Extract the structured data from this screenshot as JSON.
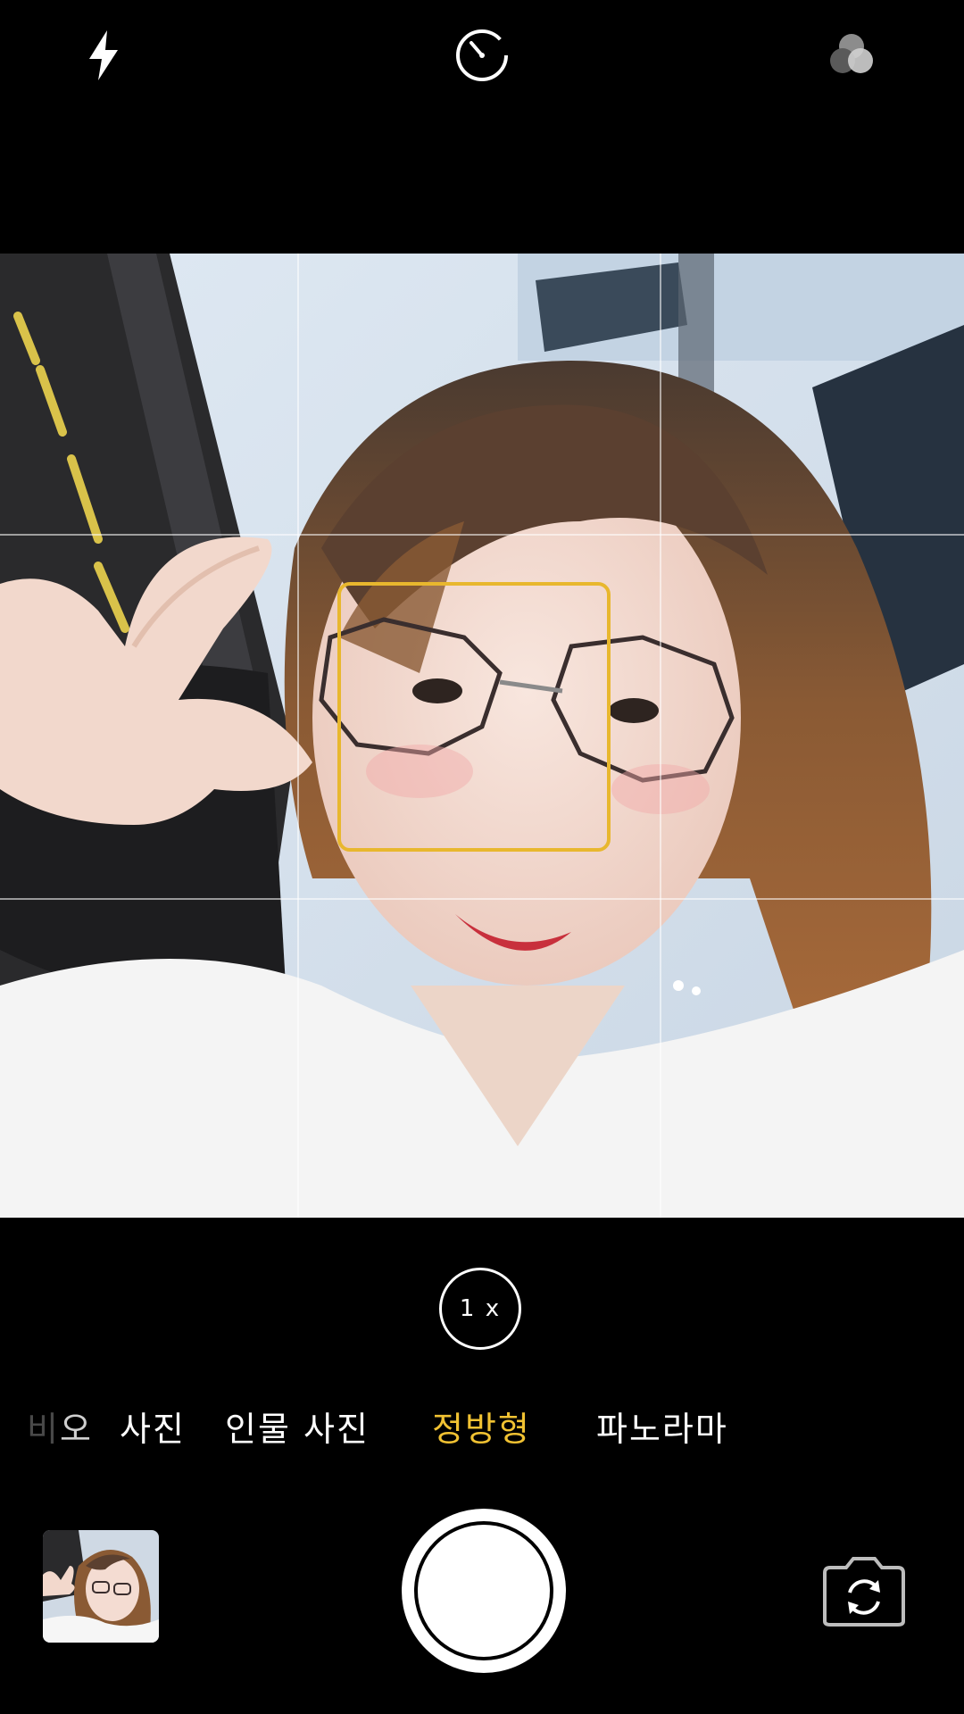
{
  "top_bar": {
    "icons": [
      "flash-icon",
      "timer-icon",
      "filter-icon"
    ]
  },
  "viewfinder": {
    "grid": true,
    "focus_color": "#e8b72e"
  },
  "zoom": {
    "label": "1 x"
  },
  "modes": {
    "video_partial_faded": "비",
    "video_partial": "오",
    "photo": "사진",
    "portrait": "인물 사진",
    "square": "정방형",
    "panorama": "파노라마",
    "selected": "정방형",
    "selected_color": "#f1c232"
  },
  "bottom_bar": {
    "icons": [
      "gallery-thumbnail",
      "shutter-button",
      "switch-camera-icon"
    ]
  }
}
